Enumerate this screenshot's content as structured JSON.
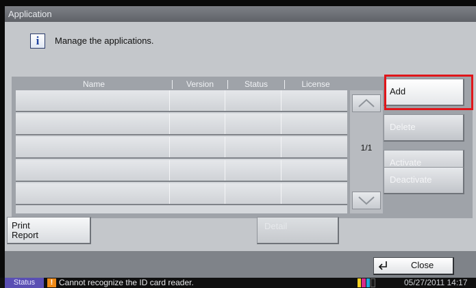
{
  "window": {
    "title": "Application"
  },
  "message": {
    "icon": "info-icon",
    "text": "Manage the applications."
  },
  "table": {
    "columns": [
      "Name",
      "Version",
      "Status",
      "License"
    ],
    "rows": [
      [
        "",
        "",
        "",
        ""
      ],
      [
        "",
        "",
        "",
        ""
      ],
      [
        "",
        "",
        "",
        ""
      ],
      [
        "",
        "",
        "",
        ""
      ],
      [
        "",
        "",
        "",
        ""
      ]
    ]
  },
  "pager": {
    "page": "1/1",
    "up_icon": "chevron-up-icon",
    "down_icon": "chevron-down-icon"
  },
  "actions": {
    "add": "Add",
    "delete": "Delete",
    "activate": "Activate",
    "deactivate": "Deactivate"
  },
  "bottom": {
    "print_report_line1": "Print",
    "print_report_line2": "Report",
    "detail": "Detail"
  },
  "footer": {
    "close": "Close",
    "close_icon": "enter-icon"
  },
  "statusbar": {
    "label": "Status",
    "warning_icon": "warning-icon",
    "message": "Cannot recognize the ID card reader.",
    "datetime": "05/27/2011 14:17",
    "toner_colors": [
      "#f5d020",
      "#d62c8a",
      "#1fa6d8",
      "#1a1a1a"
    ]
  },
  "colors": {
    "highlight": "#e0151a",
    "status_chip": "#5a4fb3",
    "warning": "#f08a17"
  }
}
